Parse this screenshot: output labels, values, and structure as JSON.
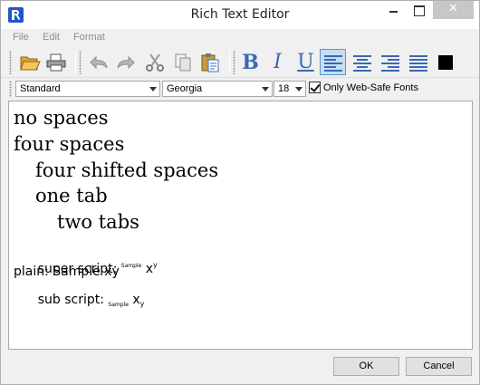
{
  "window": {
    "title": "Rich Text Editor"
  },
  "menu": {
    "file": "File",
    "edit": "Edit",
    "format": "Format"
  },
  "toolbar": {
    "icons": [
      "open-folder-icon",
      "print-icon",
      "undo-icon",
      "redo-icon",
      "cut-icon",
      "copy-icon",
      "paste-icon",
      "bold-icon",
      "italic-icon",
      "underline-icon",
      "align-left-icon",
      "align-center-icon",
      "align-right-icon",
      "justify-icon",
      "text-color-icon"
    ],
    "bold_letter": "B",
    "italic_letter": "I",
    "underline_letter": "U",
    "selected_alignment": "left",
    "accent_color": "#3b69b2",
    "text_color": "#000000"
  },
  "fontbar": {
    "style": "Standard",
    "font": "Georgia",
    "size": "18",
    "websafe_checked": true,
    "websafe_label": "Only Web-Safe Fonts"
  },
  "editor": {
    "line1": "no spaces",
    "line2": "four spaces",
    "line3": "four shifted spaces",
    "line4": "one tab",
    "line5": "two tabs",
    "superscript": {
      "label": "super script: ",
      "small": "Sample",
      "x": "x",
      "y": "y"
    },
    "plain": "plain: Sample xy",
    "subscript": {
      "label": "sub script: ",
      "small": "Sample",
      "x": "x",
      "y": "y"
    }
  },
  "footer": {
    "ok": "OK",
    "cancel": "Cancel"
  }
}
